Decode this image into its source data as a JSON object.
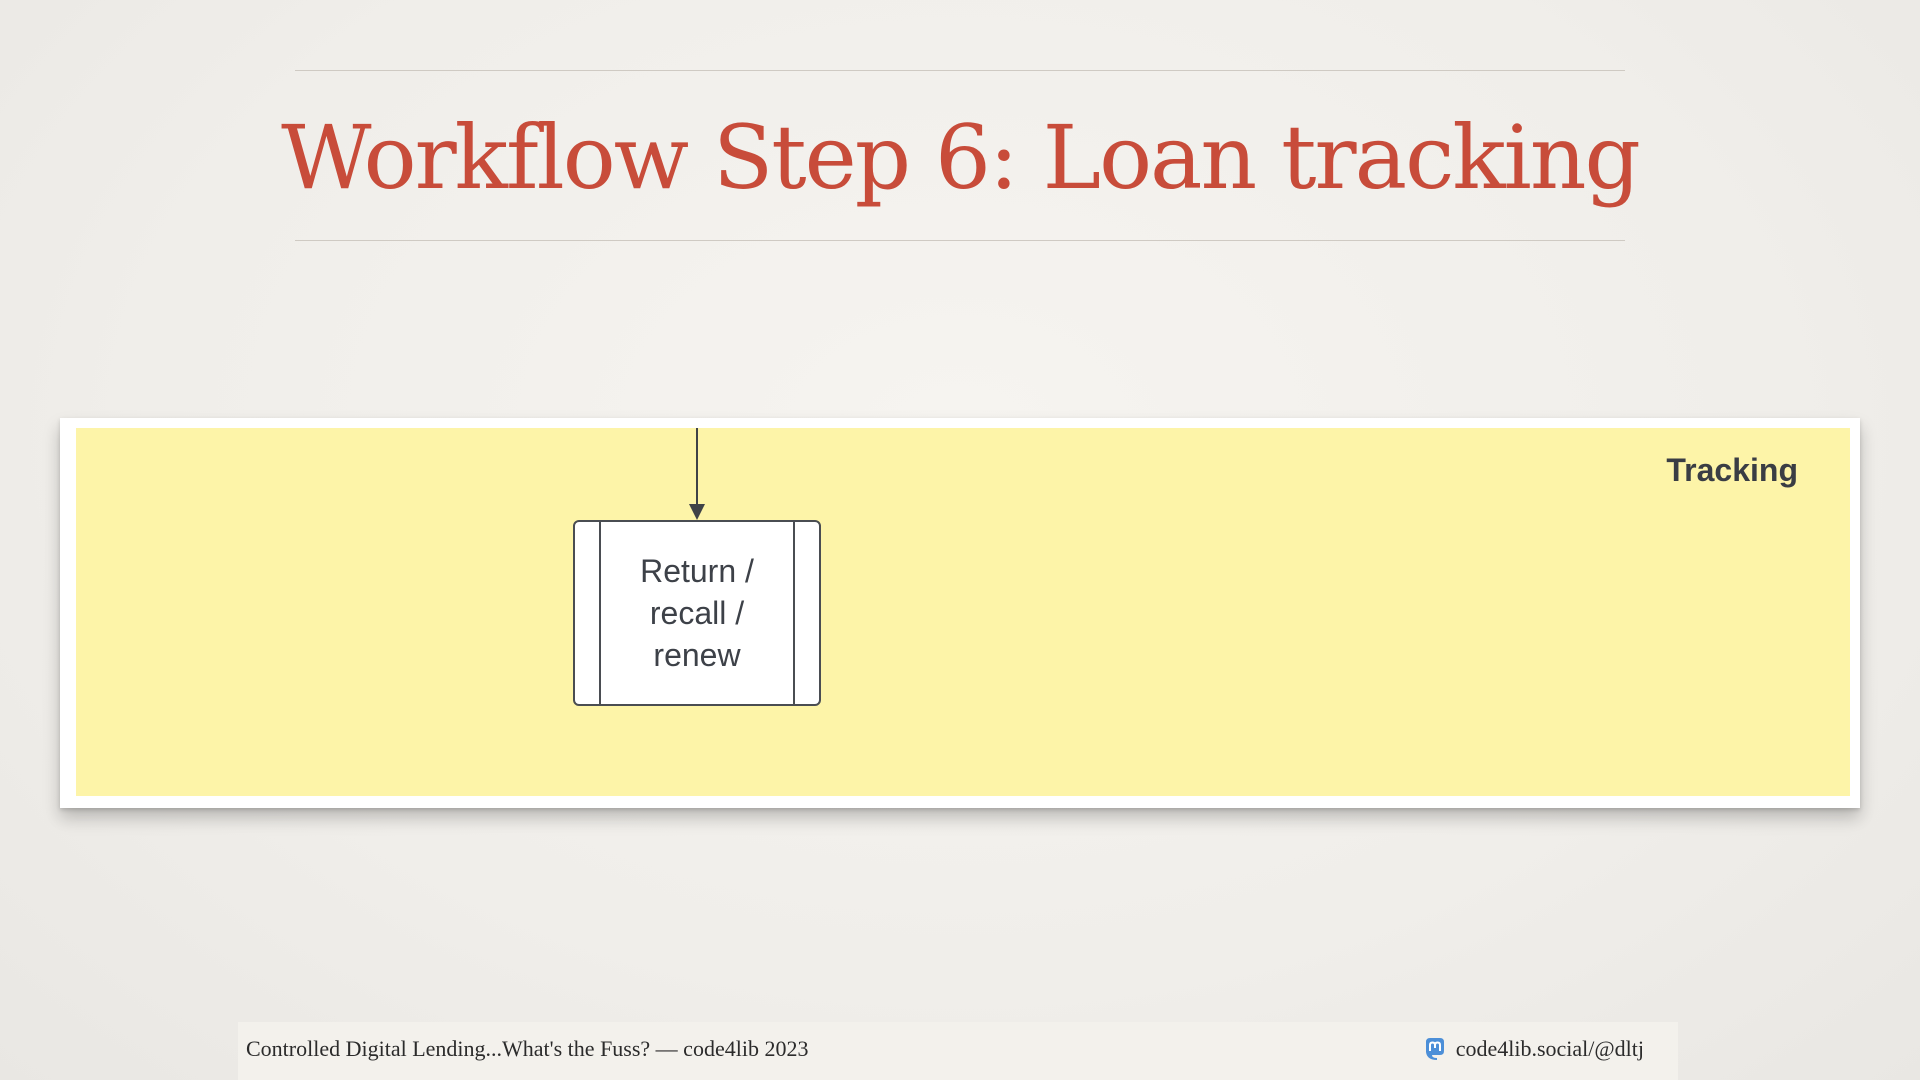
{
  "slide": {
    "title": "Workflow Step 6: Loan tracking"
  },
  "diagram": {
    "lane_label": "Tracking",
    "process_label": "Return /\nrecall /\nrenew"
  },
  "footer": {
    "left_text": "Controlled Digital Lending...What's the Fuss? — code4lib 2023",
    "right_text": "code4lib.social/@dltj",
    "right_icon": "mastodon-icon"
  },
  "colors": {
    "title": "#c84c3a",
    "lane_fill": "#fdf4a8",
    "mastodon": "#4c8fd8"
  }
}
